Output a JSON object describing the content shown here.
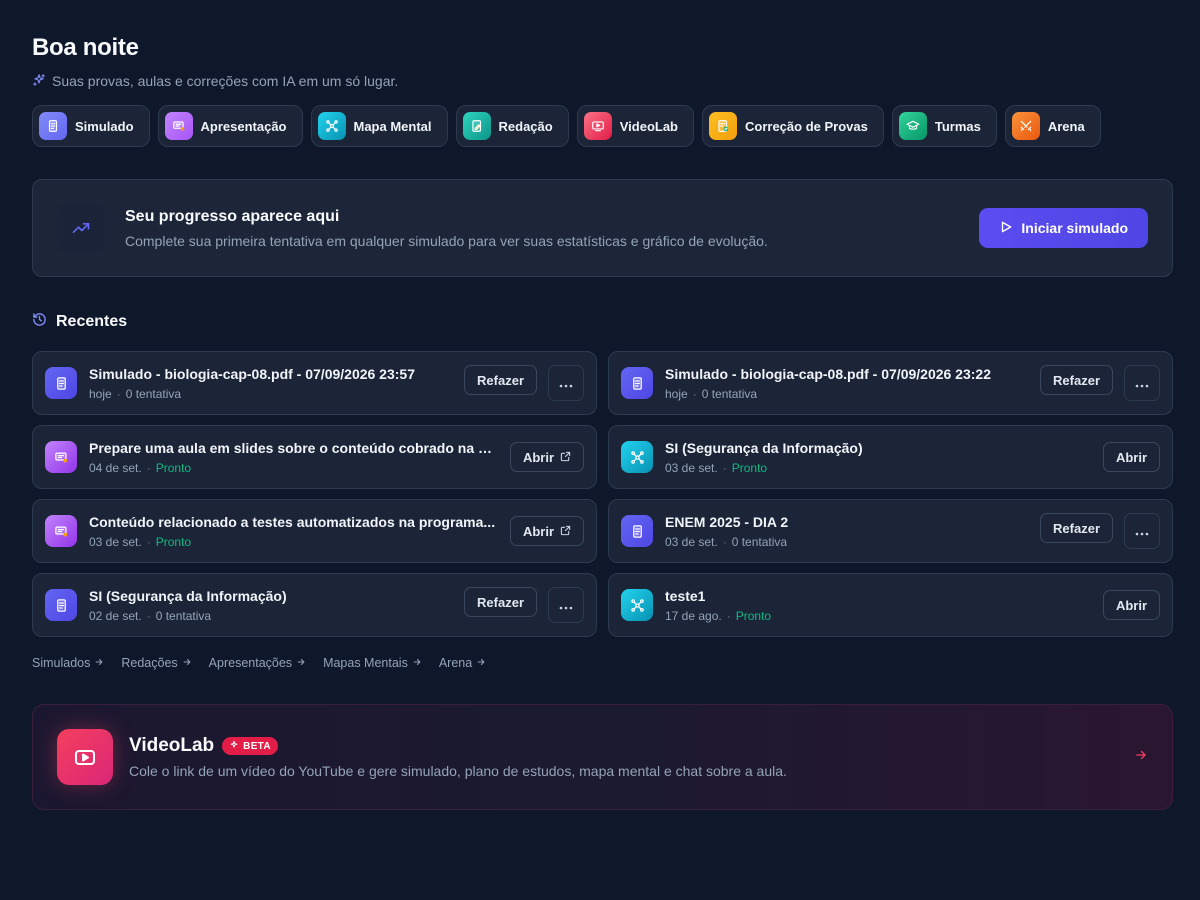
{
  "header": {
    "greeting": "Boa noite",
    "subtitle": "Suas provas, aulas e correções com IA em um só lugar."
  },
  "tools": [
    {
      "label": "Simulado",
      "icon": "document-icon",
      "color": "#6366f1"
    },
    {
      "label": "Apresentação",
      "icon": "presentation-icon",
      "color": "#a855f7"
    },
    {
      "label": "Mapa Mental",
      "icon": "mind-map-icon",
      "color": "#06b6d4"
    },
    {
      "label": "Redação",
      "icon": "pencil-doc-icon",
      "color": "#14b8a6"
    },
    {
      "label": "VideoLab",
      "icon": "video-icon",
      "color": "#f43f5e"
    },
    {
      "label": "Correção de Provas",
      "icon": "check-doc-icon",
      "color": "#f59e0b"
    },
    {
      "label": "Turmas",
      "icon": "graduation-cap-icon",
      "color": "#10b981"
    },
    {
      "label": "Arena",
      "icon": "swords-icon",
      "color": "#f97316"
    }
  ],
  "progress": {
    "title": "Seu progresso aparece aqui",
    "description": "Complete sua primeira tentativa em qualquer simulado para ver suas estatísticas e gráfico de evolução.",
    "button": "Iniciar simulado"
  },
  "recents": {
    "title": "Recentes",
    "items": [
      {
        "title": "Simulado - biologia-cap-08.pdf - 07/09/2026 23:57",
        "date": "hoje",
        "status": "0 tentativa",
        "status_ready": false,
        "type": "simulado",
        "action": "Refazer",
        "more": true
      },
      {
        "title": "Simulado - biologia-cap-08.pdf - 07/09/2026 23:22",
        "date": "hoje",
        "status": "0 tentativa",
        "status_ready": false,
        "type": "simulado",
        "action": "Refazer",
        "more": true
      },
      {
        "title": "Prepare uma aula em slides sobre o conteúdo cobrado na p...",
        "date": "04 de set.",
        "status": "Pronto",
        "status_ready": true,
        "type": "apresentacao",
        "action": "Abrir",
        "external": true,
        "more": false
      },
      {
        "title": "SI (Segurança da Informação)",
        "date": "03 de set.",
        "status": "Pronto",
        "status_ready": true,
        "type": "mapa",
        "action": "Abrir",
        "external": false,
        "more": false
      },
      {
        "title": "Conteúdo relacionado a testes automatizados na programa...",
        "date": "03 de set.",
        "status": "Pronto",
        "status_ready": true,
        "type": "apresentacao",
        "action": "Abrir",
        "external": true,
        "more": false
      },
      {
        "title": "ENEM 2025 - DIA 2",
        "date": "03 de set.",
        "status": "0 tentativa",
        "status_ready": false,
        "type": "simulado",
        "action": "Refazer",
        "more": true
      },
      {
        "title": "SI (Segurança da Informação)",
        "date": "02 de set.",
        "status": "0 tentativa",
        "status_ready": false,
        "type": "simulado",
        "action": "Refazer",
        "more": true
      },
      {
        "title": "teste1",
        "date": "17 de ago.",
        "status": "Pronto",
        "status_ready": true,
        "type": "mapa",
        "action": "Abrir",
        "external": false,
        "more": false
      }
    ]
  },
  "quick_links": [
    "Simulados",
    "Redações",
    "Apresentações",
    "Mapas Mentais",
    "Arena"
  ],
  "videolab": {
    "title": "VideoLab",
    "badge": "BETA",
    "description": "Cole o link de um vídeo do YouTube e gere simulado, plano de estudos, mapa mental e chat sobre a aula."
  },
  "colors": {
    "accent": "#4f46e5",
    "ready": "#10b981",
    "videolab": "#f43f5e"
  }
}
